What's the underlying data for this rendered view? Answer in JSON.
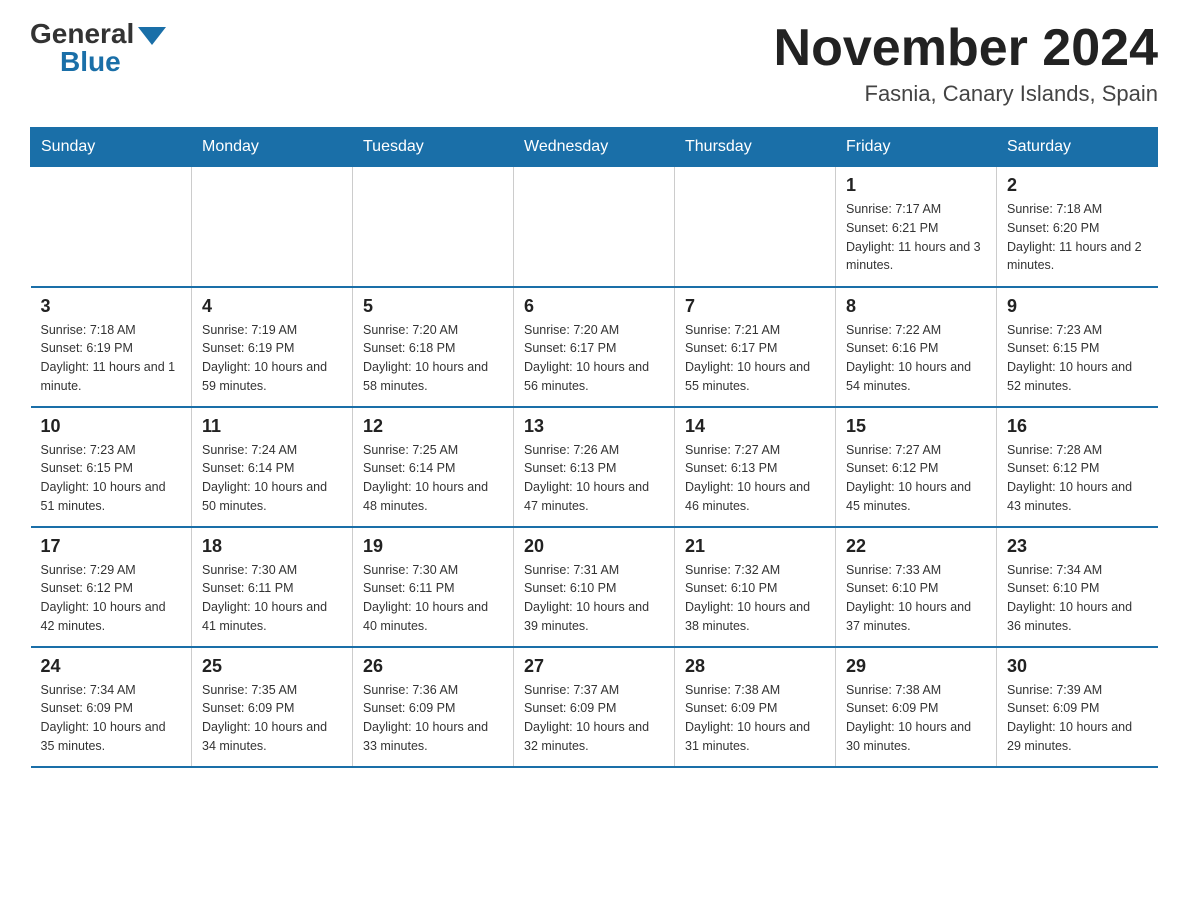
{
  "header": {
    "logo_general": "General",
    "logo_blue": "Blue",
    "title": "November 2024",
    "location": "Fasnia, Canary Islands, Spain"
  },
  "weekdays": [
    "Sunday",
    "Monday",
    "Tuesday",
    "Wednesday",
    "Thursday",
    "Friday",
    "Saturday"
  ],
  "weeks": [
    [
      {
        "day": "",
        "info": ""
      },
      {
        "day": "",
        "info": ""
      },
      {
        "day": "",
        "info": ""
      },
      {
        "day": "",
        "info": ""
      },
      {
        "day": "",
        "info": ""
      },
      {
        "day": "1",
        "info": "Sunrise: 7:17 AM\nSunset: 6:21 PM\nDaylight: 11 hours\nand 3 minutes."
      },
      {
        "day": "2",
        "info": "Sunrise: 7:18 AM\nSunset: 6:20 PM\nDaylight: 11 hours\nand 2 minutes."
      }
    ],
    [
      {
        "day": "3",
        "info": "Sunrise: 7:18 AM\nSunset: 6:19 PM\nDaylight: 11 hours\nand 1 minute."
      },
      {
        "day": "4",
        "info": "Sunrise: 7:19 AM\nSunset: 6:19 PM\nDaylight: 10 hours\nand 59 minutes."
      },
      {
        "day": "5",
        "info": "Sunrise: 7:20 AM\nSunset: 6:18 PM\nDaylight: 10 hours\nand 58 minutes."
      },
      {
        "day": "6",
        "info": "Sunrise: 7:20 AM\nSunset: 6:17 PM\nDaylight: 10 hours\nand 56 minutes."
      },
      {
        "day": "7",
        "info": "Sunrise: 7:21 AM\nSunset: 6:17 PM\nDaylight: 10 hours\nand 55 minutes."
      },
      {
        "day": "8",
        "info": "Sunrise: 7:22 AM\nSunset: 6:16 PM\nDaylight: 10 hours\nand 54 minutes."
      },
      {
        "day": "9",
        "info": "Sunrise: 7:23 AM\nSunset: 6:15 PM\nDaylight: 10 hours\nand 52 minutes."
      }
    ],
    [
      {
        "day": "10",
        "info": "Sunrise: 7:23 AM\nSunset: 6:15 PM\nDaylight: 10 hours\nand 51 minutes."
      },
      {
        "day": "11",
        "info": "Sunrise: 7:24 AM\nSunset: 6:14 PM\nDaylight: 10 hours\nand 50 minutes."
      },
      {
        "day": "12",
        "info": "Sunrise: 7:25 AM\nSunset: 6:14 PM\nDaylight: 10 hours\nand 48 minutes."
      },
      {
        "day": "13",
        "info": "Sunrise: 7:26 AM\nSunset: 6:13 PM\nDaylight: 10 hours\nand 47 minutes."
      },
      {
        "day": "14",
        "info": "Sunrise: 7:27 AM\nSunset: 6:13 PM\nDaylight: 10 hours\nand 46 minutes."
      },
      {
        "day": "15",
        "info": "Sunrise: 7:27 AM\nSunset: 6:12 PM\nDaylight: 10 hours\nand 45 minutes."
      },
      {
        "day": "16",
        "info": "Sunrise: 7:28 AM\nSunset: 6:12 PM\nDaylight: 10 hours\nand 43 minutes."
      }
    ],
    [
      {
        "day": "17",
        "info": "Sunrise: 7:29 AM\nSunset: 6:12 PM\nDaylight: 10 hours\nand 42 minutes."
      },
      {
        "day": "18",
        "info": "Sunrise: 7:30 AM\nSunset: 6:11 PM\nDaylight: 10 hours\nand 41 minutes."
      },
      {
        "day": "19",
        "info": "Sunrise: 7:30 AM\nSunset: 6:11 PM\nDaylight: 10 hours\nand 40 minutes."
      },
      {
        "day": "20",
        "info": "Sunrise: 7:31 AM\nSunset: 6:10 PM\nDaylight: 10 hours\nand 39 minutes."
      },
      {
        "day": "21",
        "info": "Sunrise: 7:32 AM\nSunset: 6:10 PM\nDaylight: 10 hours\nand 38 minutes."
      },
      {
        "day": "22",
        "info": "Sunrise: 7:33 AM\nSunset: 6:10 PM\nDaylight: 10 hours\nand 37 minutes."
      },
      {
        "day": "23",
        "info": "Sunrise: 7:34 AM\nSunset: 6:10 PM\nDaylight: 10 hours\nand 36 minutes."
      }
    ],
    [
      {
        "day": "24",
        "info": "Sunrise: 7:34 AM\nSunset: 6:09 PM\nDaylight: 10 hours\nand 35 minutes."
      },
      {
        "day": "25",
        "info": "Sunrise: 7:35 AM\nSunset: 6:09 PM\nDaylight: 10 hours\nand 34 minutes."
      },
      {
        "day": "26",
        "info": "Sunrise: 7:36 AM\nSunset: 6:09 PM\nDaylight: 10 hours\nand 33 minutes."
      },
      {
        "day": "27",
        "info": "Sunrise: 7:37 AM\nSunset: 6:09 PM\nDaylight: 10 hours\nand 32 minutes."
      },
      {
        "day": "28",
        "info": "Sunrise: 7:38 AM\nSunset: 6:09 PM\nDaylight: 10 hours\nand 31 minutes."
      },
      {
        "day": "29",
        "info": "Sunrise: 7:38 AM\nSunset: 6:09 PM\nDaylight: 10 hours\nand 30 minutes."
      },
      {
        "day": "30",
        "info": "Sunrise: 7:39 AM\nSunset: 6:09 PM\nDaylight: 10 hours\nand 29 minutes."
      }
    ]
  ]
}
